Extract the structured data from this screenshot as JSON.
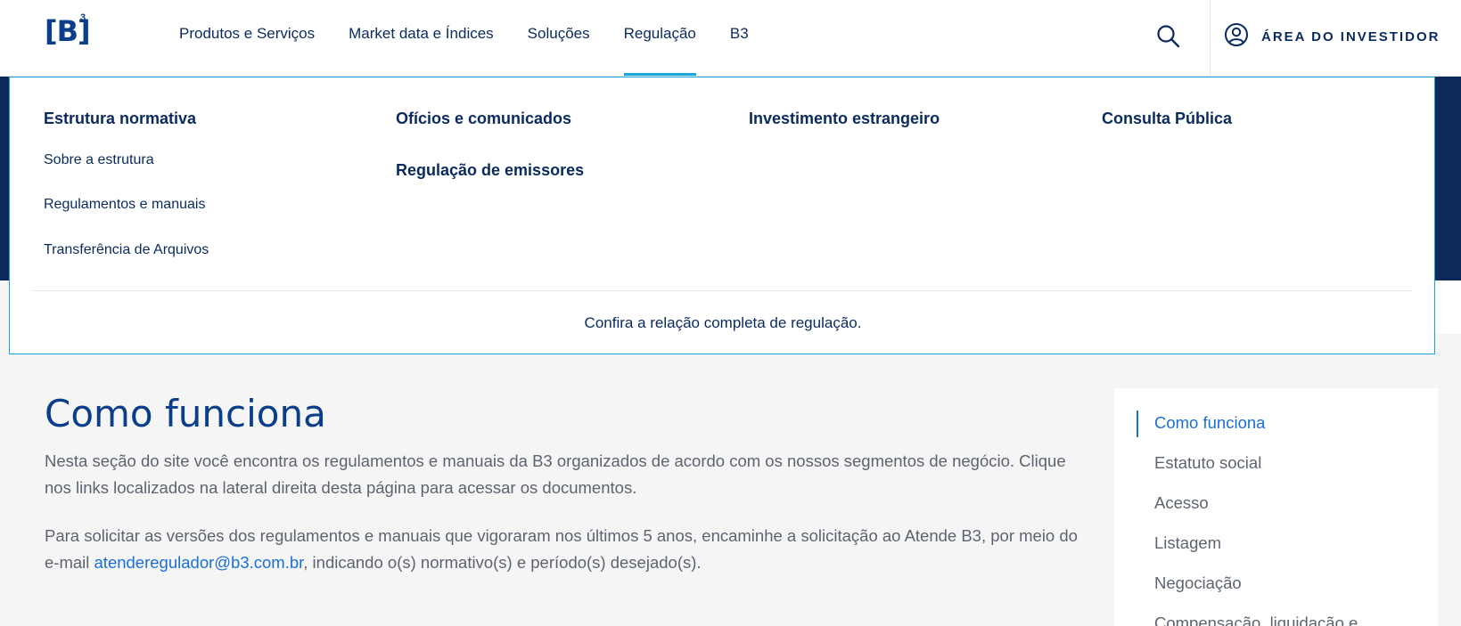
{
  "header": {
    "logo_text": "[B]",
    "logo_sup": "3",
    "nav": [
      {
        "label": "Produtos e Serviços"
      },
      {
        "label": "Market data e Índices"
      },
      {
        "label": "Soluções"
      },
      {
        "label": "Regulação",
        "active": true
      },
      {
        "label": "B3"
      }
    ],
    "search_icon": "search-icon",
    "investor_icon": "user-circle-icon",
    "investor_label": "Área do Investidor"
  },
  "mega_menu": {
    "col1": {
      "heading": "Estrutura normativa",
      "links": [
        "Sobre a estrutura",
        "Regulamentos e manuais",
        "Transferência de Arquivos"
      ]
    },
    "col2": {
      "headings": [
        "Ofícios e comunicados",
        "Regulação de emissores"
      ]
    },
    "col3": {
      "heading": "Investimento estrangeiro"
    },
    "col4": {
      "heading": "Consulta Pública"
    },
    "footer_link": "Confira a relação completa de regulação."
  },
  "main": {
    "title": "Como funciona",
    "paragraph1": "Nesta seção do site você encontra os regulamentos e manuais da B3 organizados de acordo com os nossos segmentos de negócio. Clique nos links localizados na lateral direita desta página para acessar os documentos.",
    "paragraph2_before": "Para solicitar as versões dos regulamentos e manuais que vigoraram nos últimos 5 anos, encaminhe a solicitação ao Atende B3, por meio do e-mail ",
    "paragraph2_email": "atenderegulador@b3.com.br",
    "paragraph2_after": ", indicando o(s) normativo(s) e período(s) desejado(s)."
  },
  "sidebar": {
    "items": [
      {
        "label": "Como funciona",
        "active": true
      },
      {
        "label": "Estatuto social"
      },
      {
        "label": "Acesso"
      },
      {
        "label": "Listagem"
      },
      {
        "label": "Negociação"
      },
      {
        "label": "Compensação, liquidação e"
      }
    ]
  },
  "colors": {
    "brand_navy": "#0a2a5e",
    "brand_blue": "#0a3d8a",
    "accent_cyan": "#17a6dc",
    "link_blue": "#1a6fd6",
    "band_navy": "#0b2a5b"
  }
}
